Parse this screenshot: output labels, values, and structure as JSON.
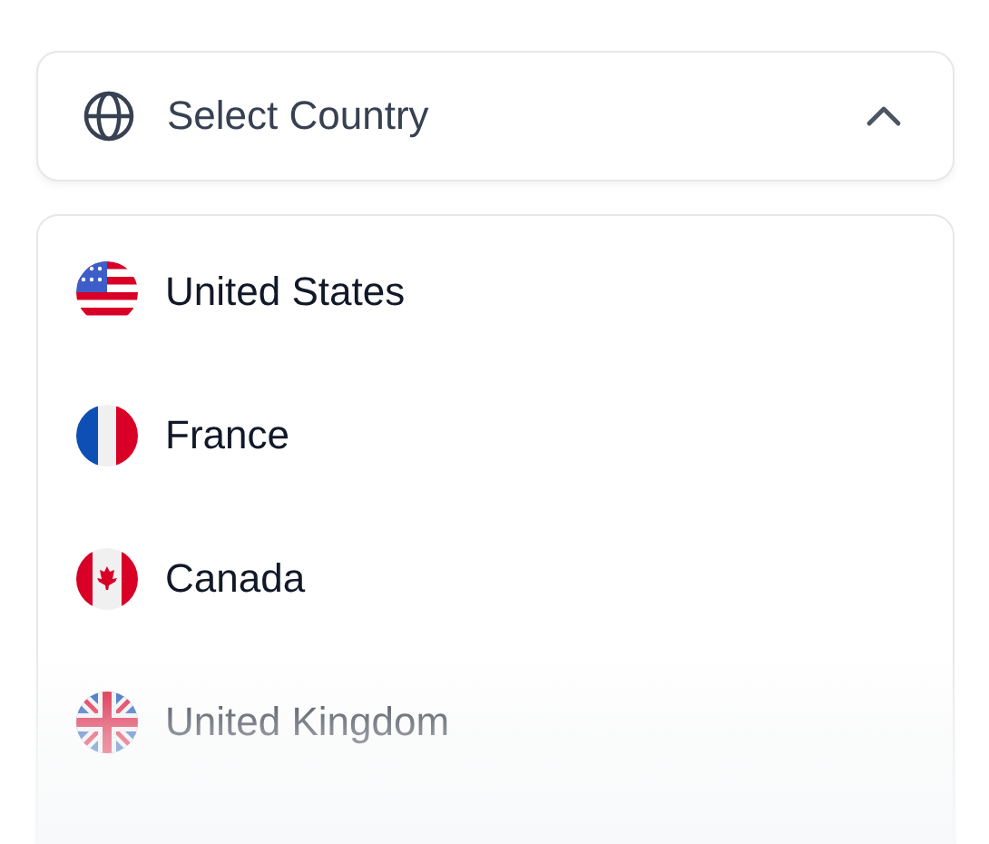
{
  "select": {
    "placeholder": "Select Country",
    "expanded": true
  },
  "options": [
    {
      "label": "United States",
      "kind": "us"
    },
    {
      "label": "France",
      "kind": "fr"
    },
    {
      "label": "Canada",
      "kind": "ca"
    },
    {
      "label": "United Kingdom",
      "kind": "uk"
    }
  ]
}
